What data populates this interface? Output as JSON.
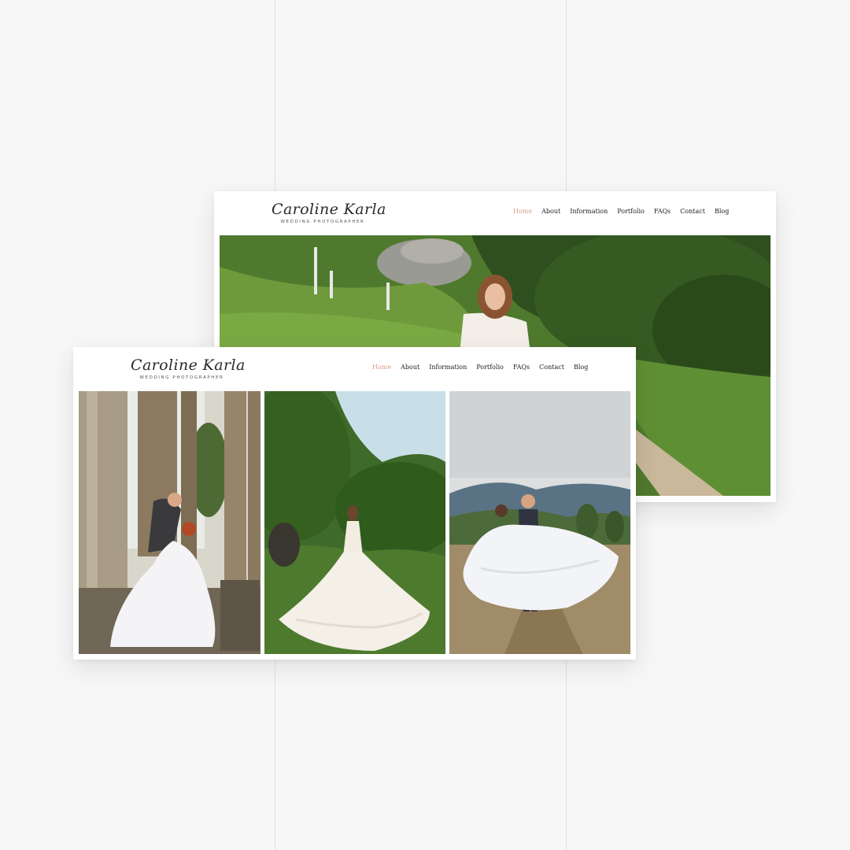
{
  "brand": {
    "name": "Caroline Karla",
    "tagline": "WEDDING PHOTOGRAPHER"
  },
  "nav": {
    "items": [
      "Home",
      "About",
      "Information",
      "Portfolio",
      "FAQs",
      "Contact",
      "Blog"
    ],
    "active_index": 0
  },
  "colors": {
    "background": "#f7f7f7",
    "accent_active_nav": "#d7a08c",
    "text": "#222222"
  }
}
